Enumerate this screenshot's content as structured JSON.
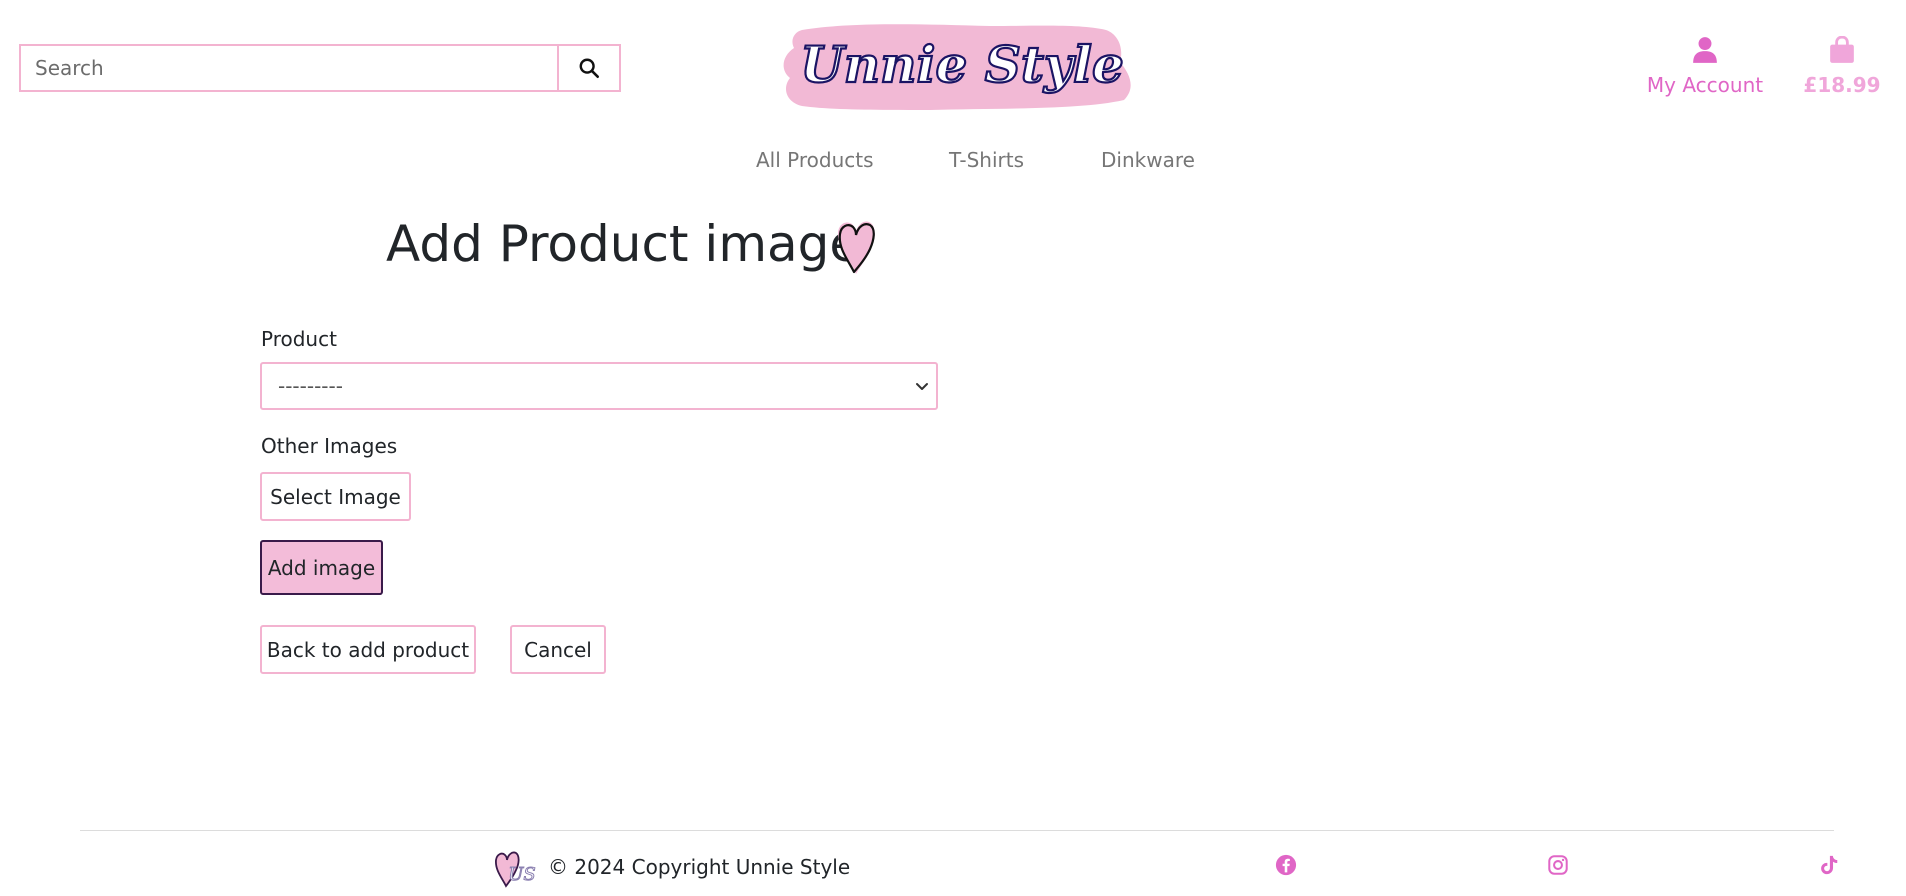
{
  "header": {
    "search": {
      "placeholder": "Search",
      "value": ""
    },
    "brand": {
      "logo_text": "Unnie Style"
    },
    "account": {
      "label": "My Account"
    },
    "cart": {
      "total": "£18.99"
    }
  },
  "nav": {
    "items": [
      {
        "label": "All Products"
      },
      {
        "label": "T-Shirts"
      },
      {
        "label": "Dinkware"
      }
    ]
  },
  "main": {
    "title": "Add Product image",
    "form": {
      "product_label": "Product",
      "product_selected": "---------",
      "other_images_label": "Other Images",
      "select_image_label": "Select Image",
      "add_image_label": "Add image",
      "back_label": "Back to add product",
      "cancel_label": "Cancel"
    }
  },
  "footer": {
    "copyright": "© 2024 Copyright Unnie Style",
    "logo_text": "US",
    "social": [
      "facebook-icon",
      "instagram-icon",
      "tiktok-icon"
    ]
  },
  "colors": {
    "accent_pink": "#f3b3d0",
    "brand_magenta": "#e066c6",
    "cart_pink": "#f0a6da",
    "logo_navy": "#1b1464",
    "primary_button_fill": "#f3bcd9"
  }
}
